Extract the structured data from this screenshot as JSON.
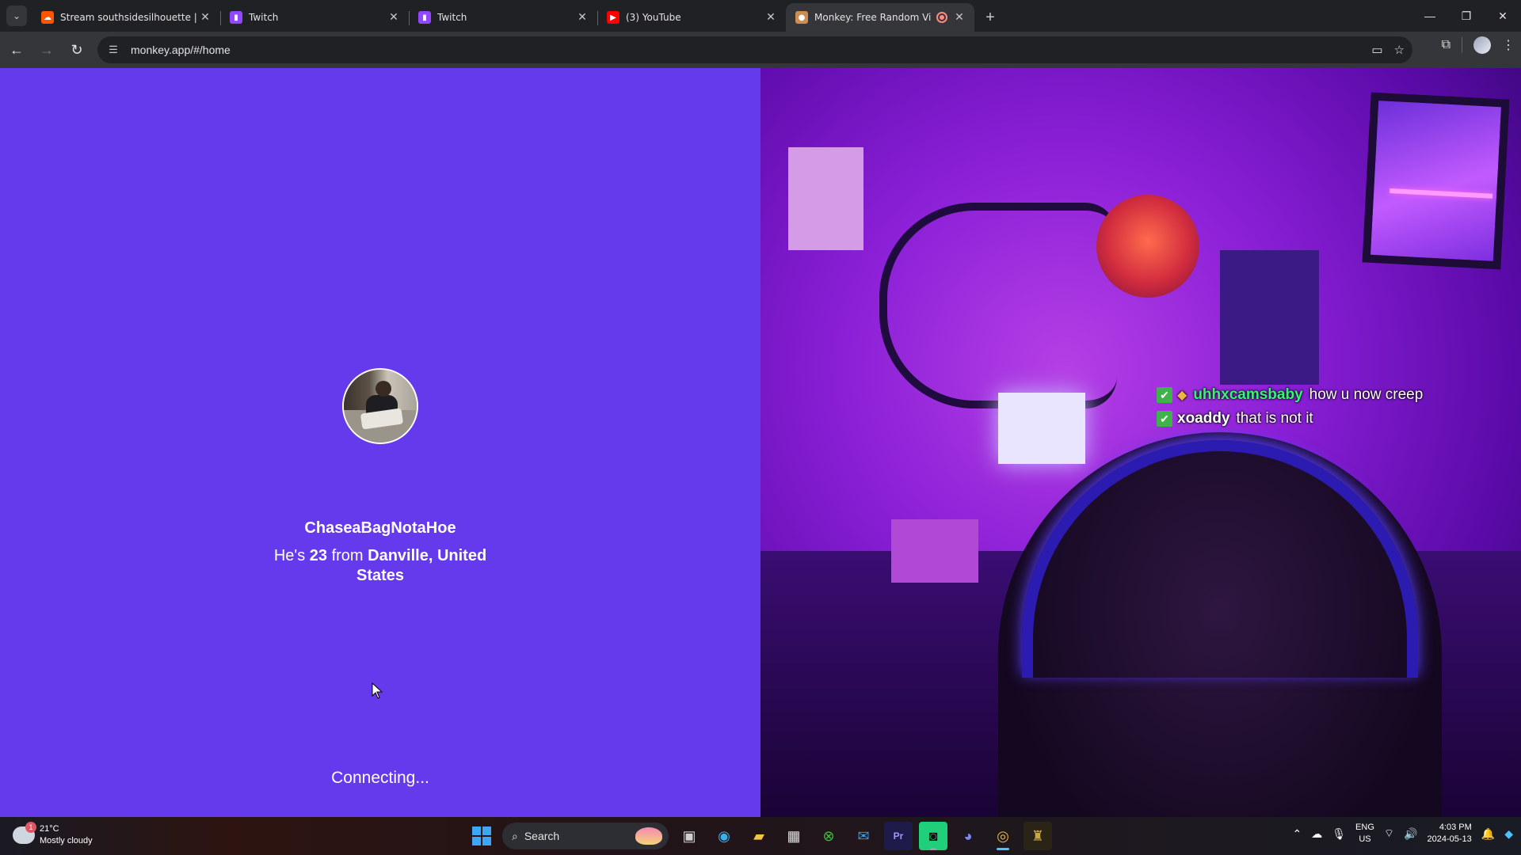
{
  "browser": {
    "tabs": [
      {
        "title": "Stream southsidesilhouette | Li",
        "favicon": "soundcloud-icon",
        "color": "#ff5500",
        "active": false
      },
      {
        "title": "Twitch",
        "favicon": "twitch-icon",
        "color": "#9146ff",
        "active": false
      },
      {
        "title": "Twitch",
        "favicon": "twitch-icon",
        "color": "#9146ff",
        "active": false
      },
      {
        "title": "(3) YouTube",
        "favicon": "youtube-icon",
        "color": "#ff0000",
        "active": false
      },
      {
        "title": "Monkey: Free Random Vide",
        "favicon": "monkey-icon",
        "color": "#f5c542",
        "active": true
      }
    ],
    "url": "monkey.app/#/home"
  },
  "profile": {
    "username": "ChaseaBagNotaHoe",
    "desc_prefix": "He's",
    "age": "23",
    "desc_from": "from",
    "location_line1": "Danville, United",
    "location_line2": "States"
  },
  "status": "Connecting...",
  "chat": [
    {
      "name": "uhhxcamsbaby",
      "message": "how u now creep",
      "name_color": "#36f47a",
      "badges": [
        "check-badge-icon",
        "diamond-badge-icon"
      ]
    },
    {
      "name": "xoaddy",
      "message": "that is not it",
      "name_color": "#ffffff",
      "badges": [
        "check-badge-icon"
      ]
    }
  ],
  "taskbar": {
    "weather_temp": "21°C",
    "weather_desc": "Mostly cloudy",
    "weather_badge": "1",
    "search_label": "Search",
    "lang_top": "ENG",
    "lang_bottom": "US",
    "time": "4:03 PM",
    "date": "2024-05-13"
  },
  "colors": {
    "left_pane": "#6539ec",
    "accent_blue": "#4cc2ff"
  }
}
